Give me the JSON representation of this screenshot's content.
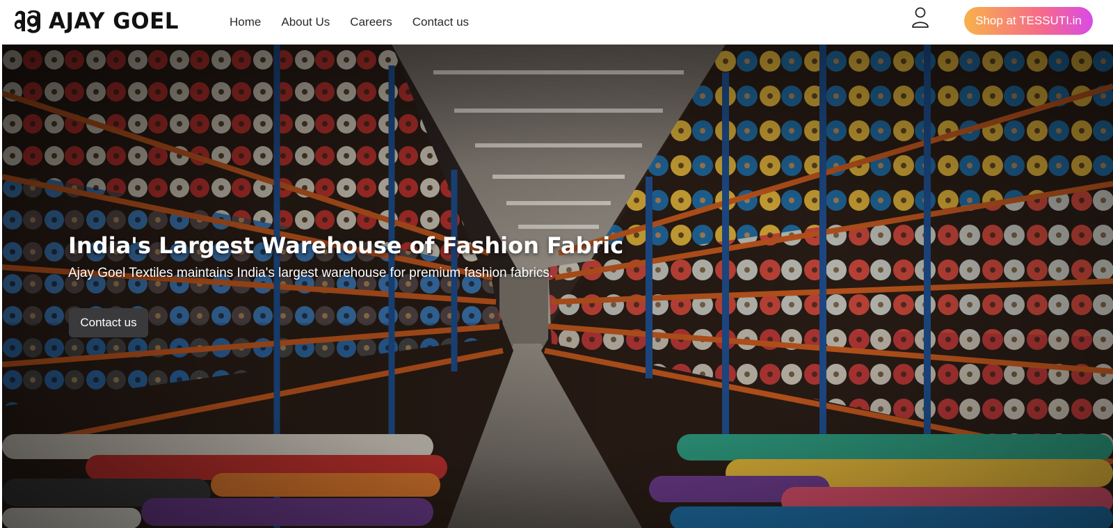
{
  "header": {
    "brand_name": "AJAY GOEL",
    "nav": {
      "home": "Home",
      "about": "About Us",
      "careers": "Careers",
      "contact": "Contact us"
    },
    "shop_button": "Shop at TESSUTI.in"
  },
  "hero": {
    "title": "India's Largest Warehouse of Fashion Fabric",
    "subtitle": "Ajay Goel Textiles maintains India's largest warehouse for premium fashion fabrics.",
    "contact_button": "Contact us"
  },
  "icons": {
    "logo": "ag-monogram-logo",
    "account": "user-icon"
  },
  "colors": {
    "shop_gradient_start": "#f7b24a",
    "shop_gradient_end": "#d94ae6",
    "hero_button_bg": "#3a3a3c",
    "warehouse_shelf_orange": "#c4581e",
    "warehouse_shelf_blue": "#1f4f8f"
  }
}
